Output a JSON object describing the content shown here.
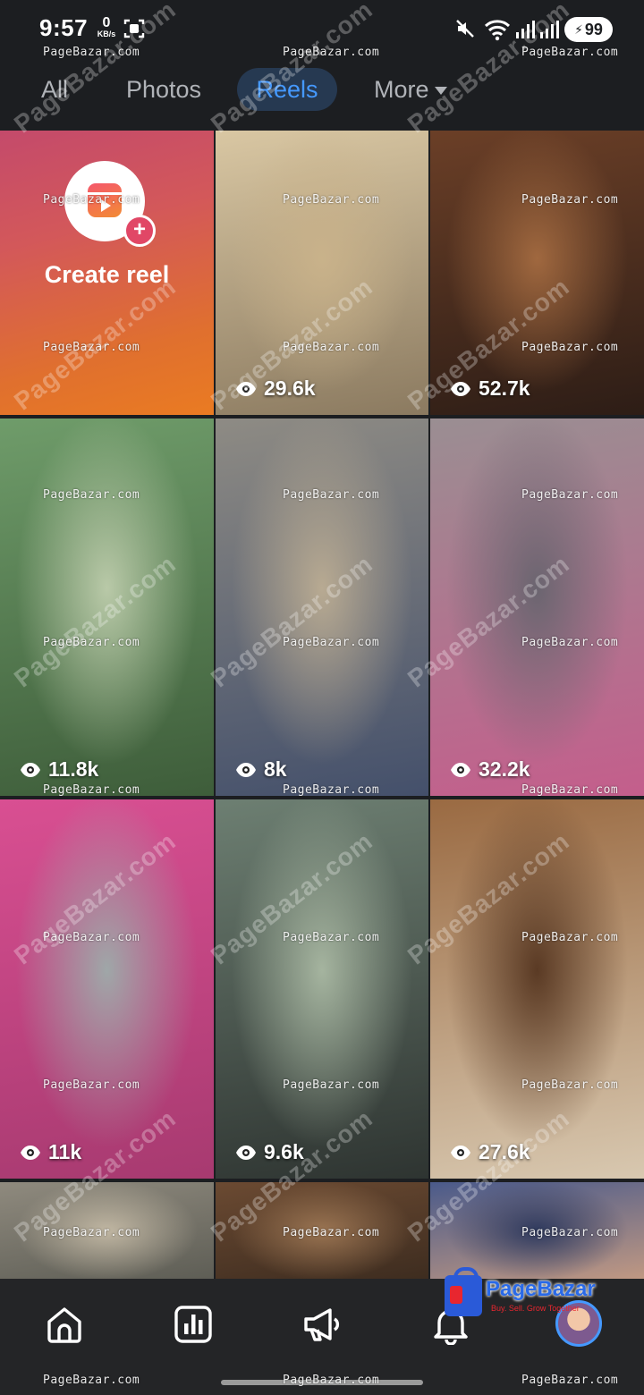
{
  "status_bar": {
    "time": "9:57",
    "network_speed_value": "0",
    "network_speed_unit": "KB/s",
    "battery_level": "99"
  },
  "tabs": [
    {
      "label": "All",
      "selected": false
    },
    {
      "label": "Photos",
      "selected": false
    },
    {
      "label": "Reels",
      "selected": true
    },
    {
      "label": "More",
      "selected": false
    }
  ],
  "create_reel": {
    "label": "Create reel"
  },
  "reels": [
    {
      "views": "29.6k",
      "thumbnail": "two toddlers sitting on pavement",
      "palette": [
        "#d9c7a3",
        "#8b7a60",
        "#c9b28a"
      ]
    },
    {
      "views": "52.7k",
      "thumbnail": "babies in a courtroom with a judge",
      "palette": [
        "#6b3f27",
        "#2d1d16",
        "#a0683f"
      ]
    },
    {
      "views": "11.8k",
      "thumbnail": "woman in green salwar on a bus",
      "palette": [
        "#6f9c6a",
        "#3e5d3a",
        "#b9c9a8"
      ]
    },
    {
      "views": "8k",
      "thumbnail": "police officer with german shepherd on street",
      "palette": [
        "#8e8b84",
        "#44506b",
        "#b8aa92"
      ]
    },
    {
      "views": "32.2k",
      "thumbnail": "passengers in pink seats inside a bus",
      "palette": [
        "#9a8e92",
        "#c45e8c",
        "#6b6570"
      ]
    },
    {
      "views": "11k",
      "thumbnail": "pink double decker bus on road",
      "palette": [
        "#d94f92",
        "#a73a70",
        "#9fa7a8"
      ]
    },
    {
      "views": "9.6k",
      "thumbnail": "woman driving a bus",
      "palette": [
        "#6d7f72",
        "#2e3431",
        "#a5b49f"
      ]
    },
    {
      "views": "27.6k",
      "thumbnail": "two toddlers at a wooden doorway",
      "palette": [
        "#9a6a42",
        "#d8c8b0",
        "#5a3a24"
      ]
    },
    {
      "views": "",
      "thumbnail": "busy street with buses and umbrellas",
      "palette": [
        "#8f8a7e",
        "#5a5a52",
        "#c0b6a2"
      ]
    },
    {
      "views": "",
      "thumbnail": "wooden interior",
      "palette": [
        "#6b4a32",
        "#3a2a1e",
        "#9a7452"
      ]
    },
    {
      "views": "",
      "thumbnail": "little girl in a decorated room",
      "palette": [
        "#4a5a8a",
        "#c99d82",
        "#2f3a5e"
      ]
    }
  ],
  "bottom_nav": [
    {
      "name": "home"
    },
    {
      "name": "insights"
    },
    {
      "name": "ads"
    },
    {
      "name": "notifications"
    },
    {
      "name": "profile"
    }
  ],
  "brand_logo": {
    "name": "PageBazar",
    "tagline": "Buy. Sell. Grow Together"
  },
  "watermark": {
    "text": "PageBazar.com"
  },
  "colors": {
    "background": "#1c1e21",
    "accent": "#4599ff",
    "tab_selected_bg": "#263951",
    "bottom_nav_bg": "#242527"
  }
}
